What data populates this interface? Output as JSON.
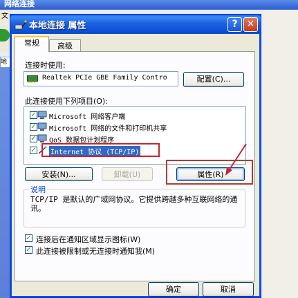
{
  "background_window": {
    "title": "网络连接",
    "menu_fragment": "文",
    "address_fragment": "地"
  },
  "dialog": {
    "title": "本地连接 属性",
    "help_label": "?",
    "close_label": "✕"
  },
  "tabs": [
    {
      "label": "常规",
      "active": true
    },
    {
      "label": "高级",
      "active": false
    }
  ],
  "connect_using": {
    "label": "连接时使用:",
    "adapter": "Realtek PCIe GBE Family Contro",
    "configure_button": "配置(C)..."
  },
  "components": {
    "label": "此连接使用下列项目(O):",
    "items": [
      {
        "label": "Microsoft 网络客户端",
        "checked": true,
        "icon": "network-client-icon"
      },
      {
        "label": "Microsoft 网络的文件和打印机共享",
        "checked": true,
        "icon": "file-printer-sharing-icon"
      },
      {
        "label": "QoS 数据包计划程序",
        "checked": true,
        "icon": "qos-scheduler-icon"
      },
      {
        "label": "Internet 协议 (TCP/IP)",
        "checked": true,
        "selected": true,
        "icon": "protocol-icon"
      }
    ]
  },
  "buttons": {
    "install": "安装(N)...",
    "uninstall": "卸载(U)",
    "properties": "属性(R)",
    "ok": "确定",
    "cancel": "取消"
  },
  "description": {
    "legend": "说明",
    "text": "TCP/IP 是默认的广域网协议。它提供跨越多种互联网络的通讯。"
  },
  "options": [
    {
      "label": "连接后在通知区域显示图标(W)",
      "checked": true
    },
    {
      "label": "此连接被限制或无连接时通知我(M)",
      "checked": true
    }
  ],
  "colors": {
    "titlebar": "#0a5ce8",
    "annotation": "#c8232c",
    "selection": "#316ac5"
  }
}
